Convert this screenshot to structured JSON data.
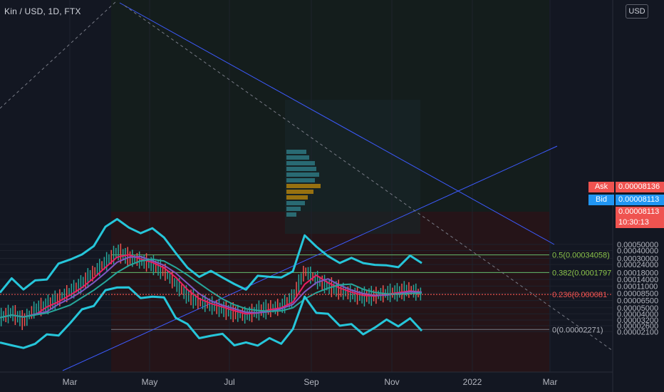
{
  "header": {
    "symbol_title": "Kin / USD, 1D, FTX",
    "currency_button": "USD"
  },
  "colors": {
    "background": "#131722",
    "ask": "#ef5350",
    "bid": "#2196f3",
    "last": "#ef5350",
    "bollinger": "#26c6da",
    "fib": "#8bc34a",
    "trend": "#3d5afe"
  },
  "chart_data": {
    "type": "line",
    "scale": "log",
    "x_ticks": [
      "Mar",
      "May",
      "Jul",
      "Sep",
      "Nov",
      "2022",
      "Mar"
    ],
    "y_ticks": [
      "0.00050000",
      "0.00040000",
      "0.00030000",
      "0.00024000",
      "0.00018000",
      "0.00014000",
      "0.00011000",
      "0.00008500",
      "0.00006500",
      "0.00005000",
      "0.00004000",
      "0.00003200",
      "0.00002600",
      "0.00002100"
    ],
    "ylim": [
      2.1e-05,
      0.0005
    ],
    "fib_levels": [
      {
        "label": "0.5(0.00034058)",
        "value": 0.00034058
      },
      {
        "label": "0.382(0.0001797",
        "value": 0.0001797
      },
      {
        "label": "0.236(0.000081",
        "value": 8.1e-05
      },
      {
        "label": "0(0.00002271)",
        "value": 2.271e-05
      }
    ],
    "price_tags": {
      "ask_label": "Ask",
      "ask_value": "0.00008136",
      "bid_label": "Bid",
      "bid_value": "0.00008113",
      "last_value": "0.00008113",
      "countdown": "10:30:13"
    },
    "series": [
      {
        "values": [
          3.5e-05,
          4.2e-05,
          3.1e-05,
          4.8e-05,
          5.5e-05,
          7e-05,
          9e-05,
          0.00012,
          0.00018,
          0.00026,
          0.00038,
          0.00031,
          0.00028,
          0.00024,
          0.00019,
          0.00012,
          7.8e-05,
          6.2e-05,
          5.5e-05,
          4.8e-05,
          4.2e-05,
          3.8e-05,
          4.5e-05,
          4.8e-05,
          5.2e-05,
          7.2e-05,
          0.00019,
          0.00014,
          0.00011,
          9.5e-05,
          8.2e-05,
          7.5e-05,
          7.8e-05,
          8.5e-05,
          8.8e-05,
          9.6e-05,
          8.1e-05
        ]
      }
    ]
  }
}
